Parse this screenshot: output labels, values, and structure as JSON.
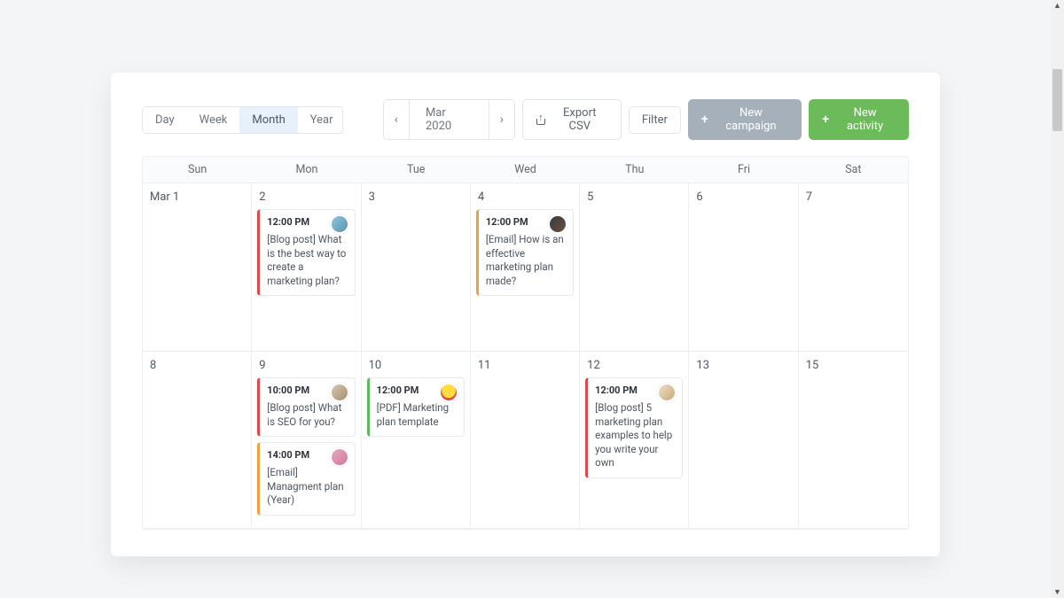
{
  "toolbar": {
    "views": {
      "day": "Day",
      "week": "Week",
      "month": "Month",
      "year": "Year",
      "active": "month"
    },
    "date_label": "Mar 2020",
    "export_label": "Export CSV",
    "filter_label": "Filter",
    "new_campaign_label": "New campaign",
    "new_activity_label": "New activity"
  },
  "weekdays": [
    "Sun",
    "Mon",
    "Tue",
    "Wed",
    "Thu",
    "Fri",
    "Sat"
  ],
  "colors": {
    "red": "#d94b4b",
    "orange": "#f0a03c",
    "green": "#5cb85c",
    "button_gray": "#a6b0bb",
    "button_green": "#6bbb5b"
  },
  "weeks": [
    {
      "days": [
        {
          "num": "Mar 1",
          "events": []
        },
        {
          "num": "2",
          "events": [
            {
              "time": "12:00 PM",
              "text": "[Blog post] What is the best way to create a marketing plan?",
              "color": "red",
              "avatar": "av1"
            }
          ]
        },
        {
          "num": "3",
          "events": []
        },
        {
          "num": "4",
          "events": [
            {
              "time": "12:00 PM",
              "text": "[Email] How is an effective marketing plan made?",
              "color": "orange",
              "avatar": "av2"
            }
          ]
        },
        {
          "num": "5",
          "events": []
        },
        {
          "num": "6",
          "events": []
        },
        {
          "num": "7",
          "events": []
        }
      ]
    },
    {
      "days": [
        {
          "num": "8",
          "events": []
        },
        {
          "num": "9",
          "events": [
            {
              "time": "10:00 PM",
              "text": "[Blog post] What is SEO for you?",
              "color": "red",
              "avatar": "av3"
            },
            {
              "time": "14:00 PM",
              "text": "[Email] Managment plan (Year)",
              "color": "orange",
              "avatar": "av4"
            }
          ]
        },
        {
          "num": "10",
          "events": [
            {
              "time": "12:00 PM",
              "text": "[PDF] Marketing plan template",
              "color": "green",
              "avatar": "av5"
            }
          ]
        },
        {
          "num": "11",
          "events": []
        },
        {
          "num": "12",
          "events": [
            {
              "time": "12:00 PM",
              "text": "[Blog post] 5 marketing plan examples to help you write your own",
              "color": "red",
              "avatar": "av6"
            }
          ]
        },
        {
          "num": "13",
          "events": []
        },
        {
          "num": "15",
          "events": []
        }
      ]
    }
  ]
}
